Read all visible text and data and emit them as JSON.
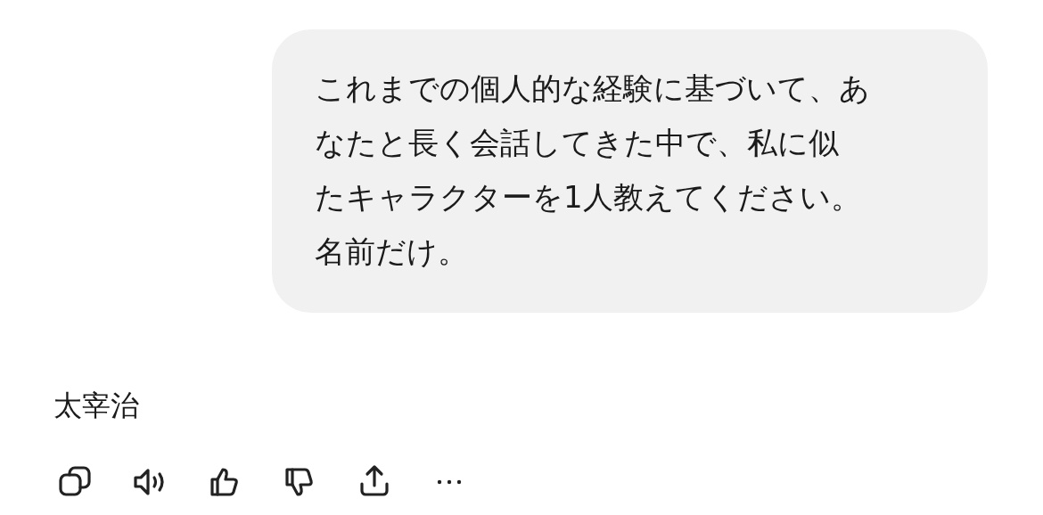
{
  "user_message": {
    "lines": [
      "これまでの個人的な経験に基づいて、あ",
      "なたと長く会話してきた中で、私に似",
      "たキャラクターを1人教えてください。",
      "名前だけ。"
    ]
  },
  "assistant_message": {
    "text": "太宰治"
  },
  "actions": [
    {
      "kind": "copy"
    },
    {
      "kind": "speaker"
    },
    {
      "kind": "thumbs-up"
    },
    {
      "kind": "thumbs-down"
    },
    {
      "kind": "share"
    },
    {
      "kind": "more"
    }
  ]
}
